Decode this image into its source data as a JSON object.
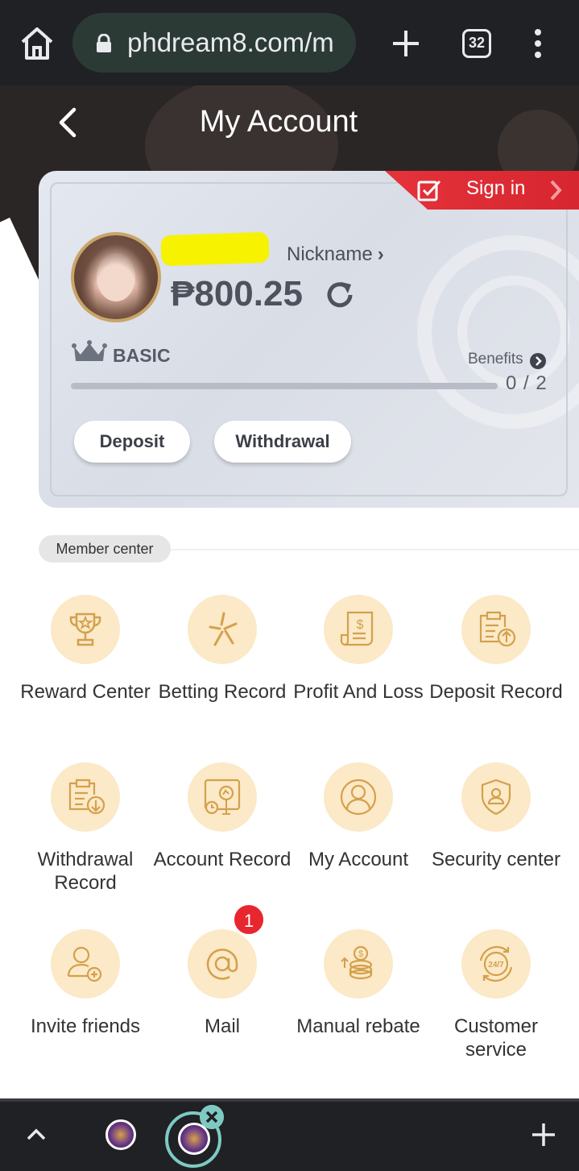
{
  "browser": {
    "url": "phdream8.com/m",
    "tab_count": "32"
  },
  "header": {
    "title": "My Account"
  },
  "account_card": {
    "sign_in_label": "Sign in",
    "nickname_label": "Nickname",
    "balance": "₱800.25",
    "tier": "BASIC",
    "benefits_label": "Benefits",
    "benefits_progress": "0 / 2",
    "benefits_fraction": 0,
    "deposit_label": "Deposit",
    "withdrawal_label": "Withdrawal"
  },
  "member_center": {
    "section_label": "Member center",
    "icon_bg": "#fbe9c7",
    "icon_color": "#d4a04c",
    "items": [
      {
        "label": "Reward Center",
        "icon": "trophy-icon"
      },
      {
        "label": "Betting Record",
        "icon": "sparkle-icon"
      },
      {
        "label": "Profit And Loss",
        "icon": "receipt-dollar-icon"
      },
      {
        "label": "Deposit Record",
        "icon": "clipboard-upload-icon"
      },
      {
        "label": "Withdrawal Record",
        "icon": "clipboard-download-icon"
      },
      {
        "label": "Account Record",
        "icon": "chart-search-icon"
      },
      {
        "label": "My Account",
        "icon": "user-circle-icon"
      },
      {
        "label": "Security center",
        "icon": "shield-user-icon"
      },
      {
        "label": "Invite friends",
        "icon": "user-plus-icon"
      },
      {
        "label": "Mail",
        "icon": "at-sign-icon",
        "badge": "1"
      },
      {
        "label": "Manual rebate",
        "icon": "coins-icon"
      },
      {
        "label": "Customer service",
        "icon": "support-247-icon"
      }
    ]
  },
  "colors": {
    "accent_red": "#e5323b",
    "gold": "#d4a04c",
    "teal": "#7ecac3"
  }
}
